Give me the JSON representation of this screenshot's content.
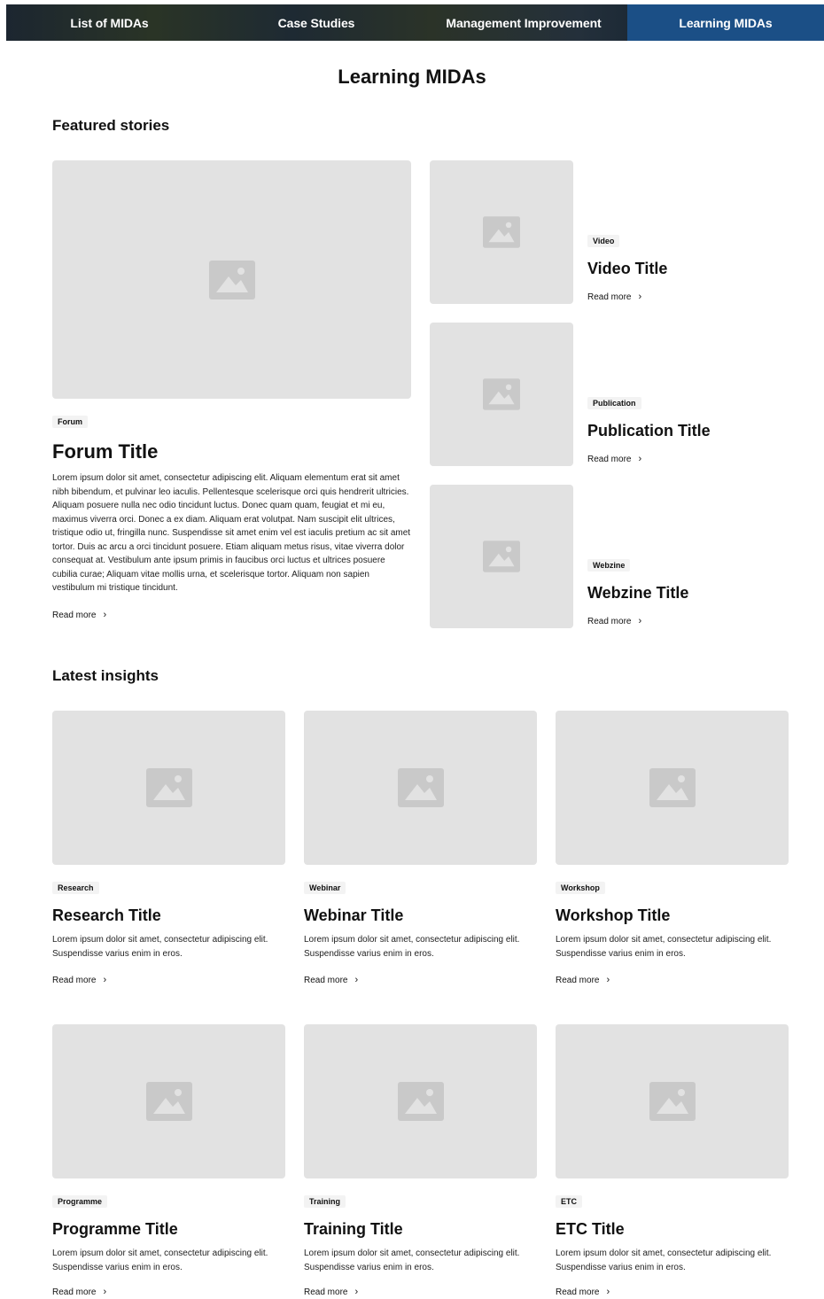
{
  "nav": {
    "items": [
      {
        "label": "List of MIDAs"
      },
      {
        "label": "Case Studies"
      },
      {
        "label": "Management Improvement"
      },
      {
        "label": "Learning MIDAs"
      }
    ]
  },
  "page_title": "Learning MIDAs",
  "featured": {
    "heading": "Featured stories",
    "main": {
      "tag": "Forum",
      "title": "Forum Title",
      "body": "Lorem ipsum dolor sit amet, consectetur adipiscing elit. Aliquam elementum erat sit amet nibh bibendum, et pulvinar leo iaculis. Pellentesque scelerisque orci quis hendrerit ultricies. Aliquam posuere nulla nec odio tincidunt luctus. Donec quam quam, feugiat et mi eu, maximus viverra orci. Donec a ex diam. Aliquam erat volutpat. Nam suscipit elit ultrices, tristique odio ut, fringilla nunc. Suspendisse sit amet enim vel est iaculis pretium ac sit amet tortor. Duis ac arcu a orci tincidunt posuere. Etiam aliquam metus risus, vitae viverra dolor consequat at. Vestibulum ante ipsum primis in faucibus orci luctus et ultrices posuere cubilia curae; Aliquam vitae mollis urna, et scelerisque tortor. Aliquam non sapien vestibulum mi tristique tincidunt.",
      "read_more": "Read more"
    },
    "side": [
      {
        "tag": "Video",
        "title": "Video Title",
        "read_more": "Read more"
      },
      {
        "tag": "Publication",
        "title": "Publication Title",
        "read_more": "Read more"
      },
      {
        "tag": "Webzine",
        "title": "Webzine Title",
        "read_more": "Read more"
      }
    ]
  },
  "latest": {
    "heading": "Latest insights",
    "cards": [
      {
        "tag": "Research",
        "title": "Research Title",
        "body": "Lorem ipsum dolor sit amet, consectetur adipiscing elit. Suspendisse varius enim in eros.",
        "read_more": "Read more"
      },
      {
        "tag": "Webinar",
        "title": "Webinar Title",
        "body": "Lorem ipsum dolor sit amet, consectetur adipiscing elit. Suspendisse varius enim in eros.",
        "read_more": "Read more"
      },
      {
        "tag": "Workshop",
        "title": "Workshop Title",
        "body": "Lorem ipsum dolor sit amet, consectetur adipiscing elit. Suspendisse varius enim in eros.",
        "read_more": "Read more"
      },
      {
        "tag": "Programme",
        "title": "Programme Title",
        "body": "Lorem ipsum dolor sit amet, consectetur adipiscing elit. Suspendisse varius enim in eros.",
        "read_more": "Read more"
      },
      {
        "tag": "Training",
        "title": "Training Title",
        "body": "Lorem ipsum dolor sit amet, consectetur adipiscing elit. Suspendisse varius enim in eros.",
        "read_more": "Read more"
      },
      {
        "tag": "ETC",
        "title": "ETC Title",
        "body": "Lorem ipsum dolor sit amet, consectetur adipiscing elit. Suspendisse varius enim in eros.",
        "read_more": "Read more"
      }
    ]
  },
  "icons": {
    "image_placeholder": "image-placeholder-icon",
    "chevron": "chevron-right-icon"
  },
  "colors": {
    "nav_active": "#1b4f86",
    "placeholder": "#e2e2e2"
  }
}
